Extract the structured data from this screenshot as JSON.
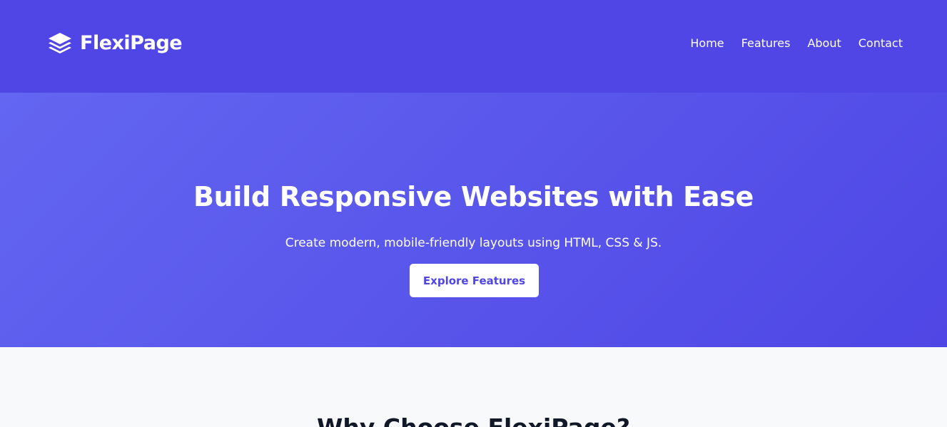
{
  "brand": {
    "name": "FlexiPage",
    "icon": "layers-icon"
  },
  "nav": {
    "items": [
      {
        "label": "Home"
      },
      {
        "label": "Features"
      },
      {
        "label": "About"
      },
      {
        "label": "Contact"
      }
    ]
  },
  "hero": {
    "title": "Build Responsive Websites with Ease",
    "subtitle": "Create modern, mobile-friendly layouts using HTML, CSS & JS.",
    "cta_label": "Explore Features"
  },
  "features": {
    "title": "Why Choose FlexiPage?"
  },
  "colors": {
    "primary": "#4f46e5",
    "primary_light": "#6366f1",
    "surface": "#f8f9fb",
    "text_dark": "#111827",
    "white": "#ffffff"
  }
}
